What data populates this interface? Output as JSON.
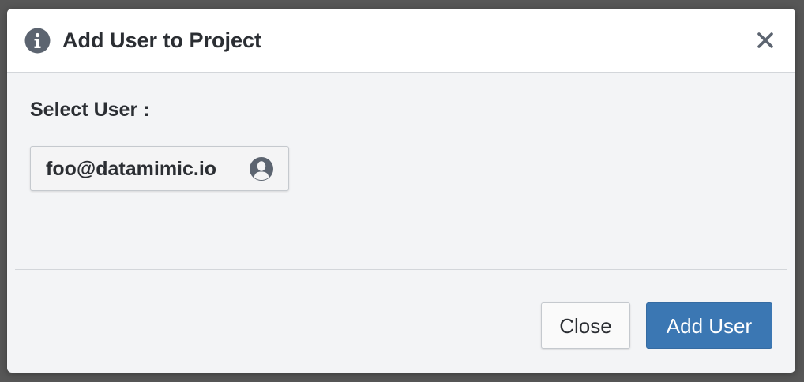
{
  "dialog": {
    "title": "Add User to Project",
    "header_icon": "info-icon",
    "close_icon": "close-icon"
  },
  "body": {
    "select_label": "Select User :",
    "selected_user": {
      "email": "foo@datamimic.io",
      "icon": "user-avatar-icon"
    }
  },
  "footer": {
    "close_label": "Close",
    "add_label": "Add User"
  },
  "colors": {
    "backdrop": "#575757",
    "header_bg": "#ffffff",
    "body_bg": "#f3f4f6",
    "text": "#2b2e33",
    "primary": "#3b77b3",
    "icon": "#5c6470"
  }
}
